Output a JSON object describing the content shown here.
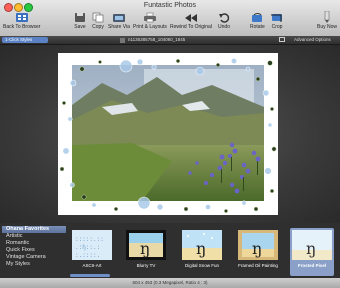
{
  "window": {
    "title": "Funtastic Photos"
  },
  "toolbar": {
    "back_label": "Back To Browser",
    "save_label": "Save",
    "copy_label": "Copy",
    "share_label": "Share Via",
    "print_label": "Print & Layouts",
    "rewind_label": "Rewind To Original",
    "undo_label": "Undo",
    "rotate_label": "Rotate",
    "crop_label": "Crop",
    "buy_label": "Buy Now"
  },
  "subbar": {
    "click_styles": "1-Click Styles",
    "filename": "n1136385758_104060_1845",
    "advanced": "Advanced Options"
  },
  "styles": {
    "categories": [
      "Ohana Favorites",
      "Artistic",
      "Romantic",
      "Quick Fixes",
      "Vintage Camera",
      "My Styles"
    ],
    "selected_index": 0
  },
  "thumbnails": [
    {
      "label": "ASCII-Art"
    },
    {
      "label": "Blurry TV"
    },
    {
      "label": "Digital Snow Fun"
    },
    {
      "label": "Framed Oil Painting"
    },
    {
      "label": "Frosted Pixel"
    }
  ],
  "status": {
    "text": "604 x 453 (0.3 Megapixel, Ratio 4 : 3)"
  },
  "colors": {
    "accent": "#5b82c4",
    "selected_thumb": "#8aa0c8"
  }
}
